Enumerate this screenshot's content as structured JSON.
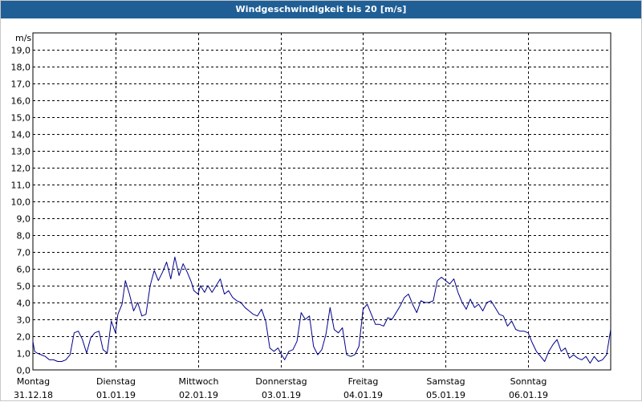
{
  "window": {
    "title": "Windgeschwindigkeit bis 20 [m/s]"
  },
  "chart_data": {
    "type": "line",
    "title": "Windgeschwindigkeit bis 20 [m/s]",
    "ylabel": "m/s",
    "ylim": [
      0,
      20
    ],
    "yticks": [
      0,
      1,
      2,
      3,
      4,
      5,
      6,
      7,
      8,
      9,
      10,
      11,
      12,
      13,
      14,
      15,
      16,
      17,
      18,
      19
    ],
    "ytick_labels": [
      "0,0",
      "1,0",
      "2,0",
      "3,0",
      "4,0",
      "5,0",
      "6,0",
      "7,0",
      "8,0",
      "9,0",
      "10,0",
      "11,0",
      "12,0",
      "13,0",
      "14,0",
      "15,0",
      "16,0",
      "17,0",
      "18,0",
      "19,0"
    ],
    "xlim": [
      0,
      7
    ],
    "day_labels": [
      {
        "day": "Montag",
        "date": "31.12.18"
      },
      {
        "day": "Dienstag",
        "date": "01.01.19"
      },
      {
        "day": "Mittwoch",
        "date": "02.01.19"
      },
      {
        "day": "Donnerstag",
        "date": "03.01.19"
      },
      {
        "day": "Freitag",
        "date": "04.01.19"
      },
      {
        "day": "Samstag",
        "date": "05.01.19"
      },
      {
        "day": "Sonntag",
        "date": "06.01.19"
      }
    ],
    "grid": true,
    "series": [
      {
        "color": "#00008b",
        "x": [
          0.0,
          0.02,
          0.05,
          0.1,
          0.15,
          0.2,
          0.25,
          0.3,
          0.35,
          0.4,
          0.45,
          0.5,
          0.55,
          0.6,
          0.65,
          0.7,
          0.75,
          0.8,
          0.85,
          0.9,
          0.95,
          1.0,
          1.03,
          1.08,
          1.12,
          1.17,
          1.22,
          1.27,
          1.32,
          1.37,
          1.42,
          1.47,
          1.52,
          1.57,
          1.62,
          1.67,
          1.72,
          1.77,
          1.82,
          1.87,
          1.92,
          1.95,
          2.0,
          2.03,
          2.08,
          2.12,
          2.17,
          2.22,
          2.27,
          2.32,
          2.37,
          2.42,
          2.47,
          2.52,
          2.57,
          2.62,
          2.67,
          2.72,
          2.77,
          2.82,
          2.87,
          2.92,
          2.97,
          3.0,
          3.05,
          3.1,
          3.15,
          3.2,
          3.25,
          3.3,
          3.35,
          3.4,
          3.45,
          3.5,
          3.55,
          3.6,
          3.65,
          3.7,
          3.75,
          3.8,
          3.85,
          3.9,
          3.95,
          4.0,
          4.05,
          4.1,
          4.15,
          4.2,
          4.25,
          4.3,
          4.35,
          4.4,
          4.45,
          4.5,
          4.55,
          4.6,
          4.65,
          4.7,
          4.75,
          4.8,
          4.85,
          4.9,
          4.95,
          5.0,
          5.05,
          5.1,
          5.15,
          5.2,
          5.25,
          5.3,
          5.35,
          5.4,
          5.45,
          5.5,
          5.55,
          5.6,
          5.65,
          5.7,
          5.75,
          5.8,
          5.85,
          5.9,
          5.95,
          6.0,
          6.05,
          6.1,
          6.15,
          6.2,
          6.25,
          6.3,
          6.35,
          6.4,
          6.45,
          6.5,
          6.55,
          6.6,
          6.65,
          6.7,
          6.75,
          6.8,
          6.85,
          6.9,
          6.95,
          7.0
        ],
        "y": [
          1.7,
          1.1,
          1.0,
          0.9,
          0.8,
          0.6,
          0.6,
          0.5,
          0.5,
          0.6,
          0.9,
          2.2,
          2.3,
          1.8,
          1.0,
          1.9,
          2.2,
          2.3,
          1.2,
          1.0,
          2.9,
          2.2,
          3.3,
          3.9,
          5.3,
          4.5,
          3.5,
          4.0,
          3.2,
          3.3,
          5.0,
          5.9,
          5.3,
          5.8,
          6.4,
          5.4,
          6.7,
          5.6,
          6.3,
          5.8,
          5.2,
          4.7,
          4.5,
          5.0,
          4.6,
          5.0,
          4.6,
          5.0,
          5.4,
          4.5,
          4.7,
          4.3,
          4.1,
          4.0,
          3.7,
          3.5,
          3.3,
          3.2,
          3.6,
          2.9,
          1.3,
          1.1,
          1.3,
          1.0,
          0.6,
          1.1,
          1.2,
          1.7,
          3.4,
          3.0,
          3.2,
          1.4,
          0.9,
          1.2,
          2.1,
          3.7,
          2.4,
          2.2,
          2.5,
          0.9,
          0.8,
          0.9,
          1.4,
          3.6,
          3.9,
          3.3,
          2.7,
          2.7,
          2.6,
          3.1,
          3.0,
          3.4,
          3.8,
          4.3,
          4.5,
          3.9,
          3.4,
          4.1,
          4.0,
          4.0,
          4.1,
          5.3,
          5.5,
          5.3,
          5.1,
          5.4,
          4.6,
          4.0,
          3.6,
          4.2,
          3.7,
          3.9,
          3.5,
          4.0,
          4.1,
          3.7,
          3.3,
          3.2,
          2.6,
          2.9,
          2.4,
          2.3,
          2.3,
          2.2,
          1.6,
          1.1,
          0.8,
          0.5,
          1.1,
          1.5,
          1.8,
          1.1,
          1.3,
          0.7,
          0.9,
          0.7,
          0.6,
          0.8,
          0.4,
          0.8,
          0.5,
          0.6,
          0.9,
          2.4
        ]
      }
    ]
  }
}
